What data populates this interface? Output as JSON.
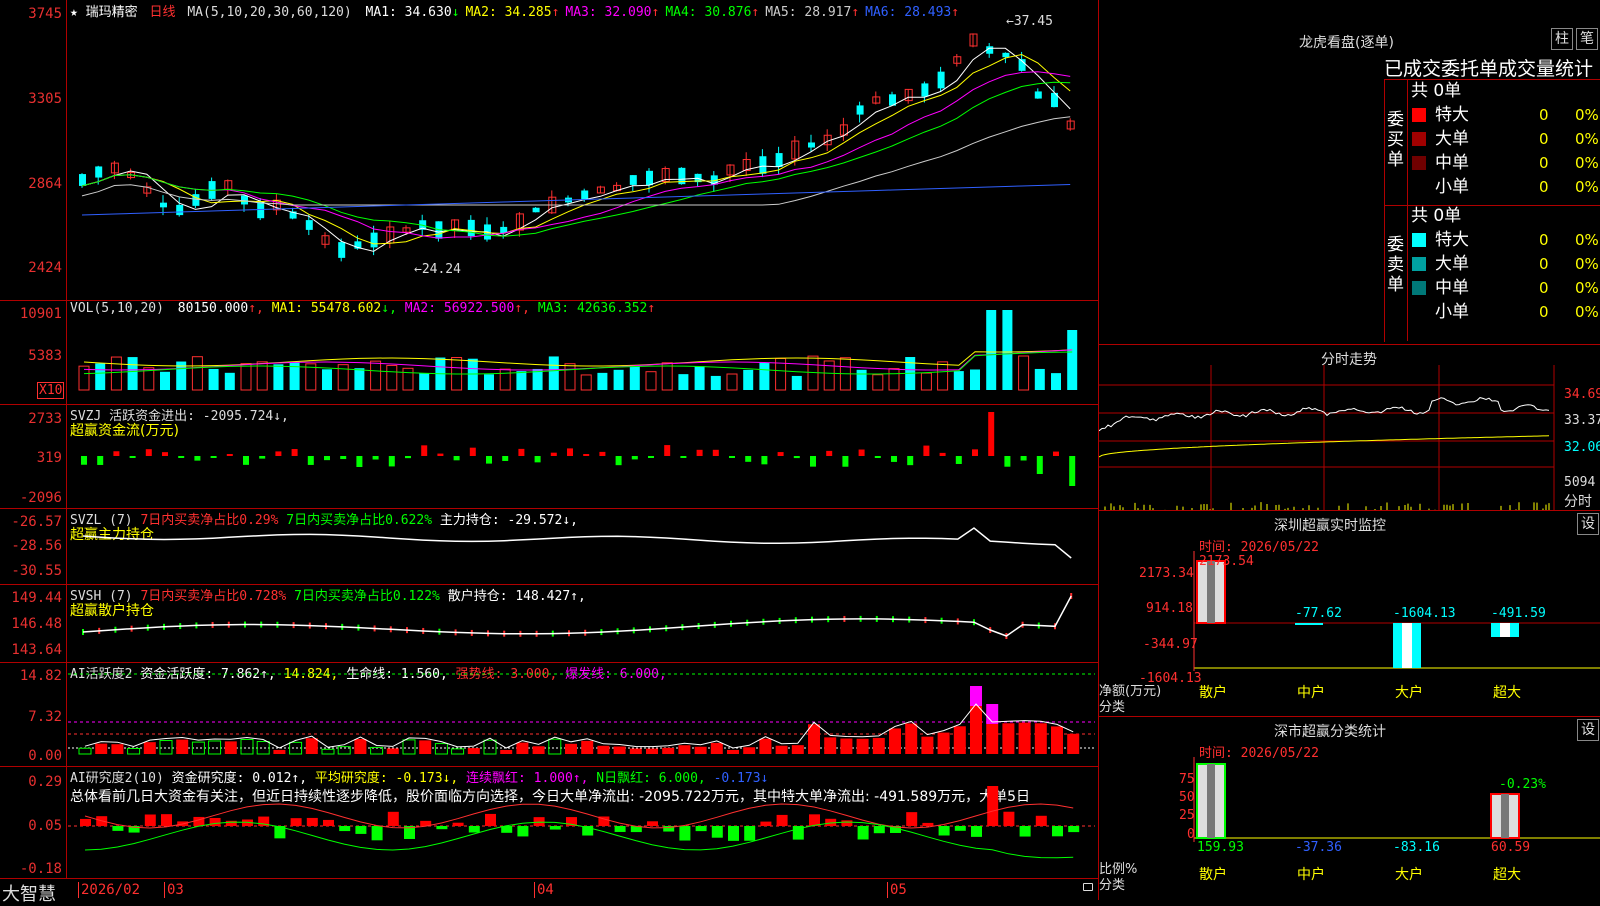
{
  "stock": {
    "star": "★",
    "name": "瑞玛精密",
    "period": "日线"
  },
  "price_panel": {
    "ma_label": "MA(5,10,20,30,60,120)",
    "ma": [
      {
        "label": "MA1: 34.630",
        "arrow": "↓",
        "color": "#ffffff"
      },
      {
        "label": "MA2: 34.285",
        "arrow": "↑",
        "color": "#ffff00"
      },
      {
        "label": "MA3: 32.090",
        "arrow": "↑",
        "color": "#ff00ff"
      },
      {
        "label": "MA4: 30.876",
        "arrow": "↑",
        "color": "#00ff00"
      },
      {
        "label": "MA5: 28.917",
        "arrow": "↑",
        "color": "#cccccc"
      },
      {
        "label": "MA6: 28.493",
        "arrow": "↑",
        "color": "#3060ff"
      }
    ],
    "yticks": [
      "3745",
      "3305",
      "2864",
      "2424"
    ],
    "high_label": "37.45",
    "low_label": "24.24"
  },
  "vol_panel": {
    "header": "VOL(5,10,20)",
    "value": "80150.000",
    "ma1": "MA1: 55478.602",
    "ma2": "MA2: 56922.500",
    "ma3": "MA3: 42636.352",
    "yticks": [
      "10901",
      "5383"
    ],
    "unit": "X10"
  },
  "svzj_panel": {
    "header": "SVZJ  活跃资金进出: -2095.724↓,",
    "sub": "超赢资金流(万元)",
    "yticks": [
      "2733",
      "319",
      "-2096"
    ]
  },
  "svzl_panel": {
    "name": "SVZL (7)",
    "a": "7日内买卖净占比0.29%",
    "b": "7日内买卖净占比0.622%",
    "c": "主力持仓: -29.572↓,",
    "sub": "超赢主力持仓",
    "yticks": [
      "-26.57",
      "-28.56",
      "-30.55"
    ]
  },
  "svsh_panel": {
    "name": "SVSH (7)",
    "a": "7日内买卖净占比0.728%",
    "b": "7日内买卖净占比0.122%",
    "c": "散户持仓: 148.427↑,",
    "sub": "超赢散户持仓",
    "yticks": [
      "149.44",
      "146.48",
      "143.64"
    ]
  },
  "ai_active_panel": {
    "name": "AI活跃度2",
    "a": "资金活跃度: 7.862↑,",
    "b": "14.824,",
    "c": "生命线: 1.560,",
    "d": "强势线: 3.000,",
    "e": "爆发线: 6.000,",
    "yticks": [
      "14.82",
      "7.32",
      "0.00"
    ]
  },
  "ai_research_panel": {
    "name": "AI研究度2(10)",
    "a": "资金研究度: 0.012↑,",
    "b": "平均研究度: -0.173↓,",
    "c": "连续飘红: 1.000↑,",
    "d": "N日飘红: 6.000,",
    "e": "-0.173↓",
    "commentary": "总体看前几日大资金有关注，但近日持续性逐步降低，股价面临方向选择，今日大单净流出: -2095.722万元，其中特大单净流出: -491.589万元，大单5日",
    "yticks": [
      "0.29",
      "0.05",
      "-0.18"
    ]
  },
  "bottom_bar": {
    "brand": "大智慧",
    "dates": [
      "2026/02",
      "03",
      "04",
      "05"
    ]
  },
  "dragon_tiger": {
    "title": "龙虎看盘(逐单)",
    "btn_bar": "柱",
    "btn_pen": "笔",
    "table_title": "已成交委托单成交量统计",
    "buy_label": "委买单",
    "sell_label": "委卖单",
    "buy_total": "共 0单",
    "sell_total": "共 0单",
    "buy_rows": [
      {
        "label": "特大",
        "count": "0",
        "pct": "0%",
        "color": "#ff0000"
      },
      {
        "label": "大单",
        "count": "0",
        "pct": "0%",
        "color": "#a00000"
      },
      {
        "label": "中单",
        "count": "0",
        "pct": "0%",
        "color": "#700000"
      },
      {
        "label": "小单",
        "count": "0",
        "pct": "0%",
        "color": ""
      }
    ],
    "sell_rows": [
      {
        "label": "特大",
        "count": "0",
        "pct": "0%",
        "color": "#00ffff"
      },
      {
        "label": "大单",
        "count": "0",
        "pct": "0%",
        "color": "#00a0a0"
      },
      {
        "label": "中单",
        "count": "0",
        "pct": "0%",
        "color": "#007878"
      },
      {
        "label": "小单",
        "count": "0",
        "pct": "0%",
        "color": ""
      }
    ]
  },
  "intraday": {
    "title": "分时走势",
    "yticks": [
      "34.69",
      "33.37",
      "32.06",
      "5094"
    ],
    "unit": "分时"
  },
  "sz_monitor": {
    "title": "深圳超赢实时监控",
    "btn": "设",
    "time": "时间: 2026/05/22",
    "yticks": [
      "2173.34",
      "914.18",
      "-344.97",
      "-1604.13"
    ],
    "top_value": "2173.54",
    "axis_label": "净额(万元)",
    "cat_label": "分类",
    "categories": [
      "散户",
      "中户",
      "大户",
      "超大"
    ],
    "values": [
      "",
      "-77.62",
      "-1604.13",
      "-491.59"
    ]
  },
  "sz_category": {
    "title": "深市超赢分类统计",
    "btn": "设",
    "time": "时间: 2026/05/22",
    "yticks": [
      "75",
      "50",
      "25",
      "0"
    ],
    "axis_label": "比例%",
    "cat_label": "分类",
    "categories": [
      "散户",
      "中户",
      "大户",
      "超大"
    ],
    "values": [
      "159.93",
      "-37.36",
      "-83.16",
      "60.59"
    ],
    "pct_label": "-0.23%"
  }
}
